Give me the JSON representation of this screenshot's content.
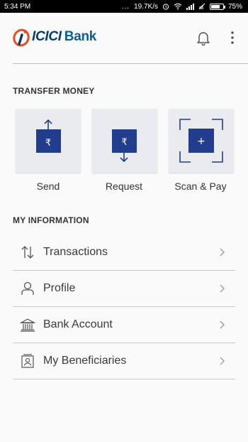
{
  "status_bar": {
    "time": "5:34 PM",
    "more": "...",
    "network_speed": "19.7K/s",
    "battery_percent": "75%",
    "battery_level": 0.75
  },
  "header": {
    "brand_name": "ICICI",
    "brand_suffix": "Bank",
    "brand_color": "#053c6d",
    "accent_color": "#e8491e",
    "icons": {
      "notification": "bell-icon",
      "menu": "kebab-menu-icon"
    }
  },
  "transfer": {
    "heading": "TRANSFER MONEY",
    "tile_icon_color": "#233d8e",
    "tiles": [
      {
        "label": "Send",
        "icon": "send-rupee-icon",
        "glyph": "₹"
      },
      {
        "label": "Request",
        "icon": "request-rupee-icon",
        "glyph": "₹"
      },
      {
        "label": "Scan & Pay",
        "icon": "scan-qr-icon",
        "glyph": "+"
      }
    ]
  },
  "info": {
    "heading": "MY INFORMATION",
    "items": [
      {
        "label": "Transactions",
        "icon": "transfer-arrows-icon"
      },
      {
        "label": "Profile",
        "icon": "user-icon"
      },
      {
        "label": "Bank Account",
        "icon": "bank-building-icon"
      },
      {
        "label": "My Beneficiaries",
        "icon": "beneficiary-card-icon"
      }
    ]
  }
}
